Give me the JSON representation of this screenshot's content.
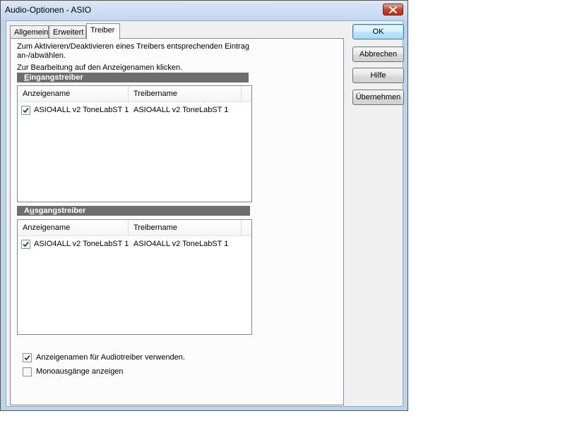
{
  "window": {
    "title": "Audio-Optionen - ASIO"
  },
  "tabs": [
    {
      "label": "Allgemein"
    },
    {
      "label": "Erweitert"
    },
    {
      "label": "Treiber"
    }
  ],
  "description": {
    "line1": "Zum Aktivieren/Deaktivieren eines Treibers entsprechenden Eintrag",
    "line2": "an-/abwählen.",
    "line3": "Zur Bearbeitung auf den Anzeigenamen klicken."
  },
  "input_group": {
    "header_mnemonic": "E",
    "header_rest": "ingangstreiber",
    "columns": [
      "Anzeigename",
      "Treibername"
    ],
    "rows": [
      {
        "checked": true,
        "display_name": "ASIO4ALL v2 ToneLabST 1",
        "driver_name": "ASIO4ALL v2 ToneLabST 1"
      }
    ]
  },
  "output_group": {
    "header_pre": "A",
    "header_mnemonic": "u",
    "header_rest": "sgangstreiber",
    "columns": [
      "Anzeigename",
      "Treibername"
    ],
    "rows": [
      {
        "checked": true,
        "display_name": "ASIO4ALL v2 ToneLabST 1",
        "driver_name": "ASIO4ALL v2 ToneLabST 1"
      }
    ]
  },
  "options": [
    {
      "label": "Anzeigenamen für Audiotreiber verwenden.",
      "checked": true
    },
    {
      "label": "Monoausgänge anzeigen",
      "checked": false
    }
  ],
  "buttons": {
    "ok": "OK",
    "cancel": "Abbrechen",
    "help": "Hilfe",
    "apply": "Übernehmen"
  }
}
